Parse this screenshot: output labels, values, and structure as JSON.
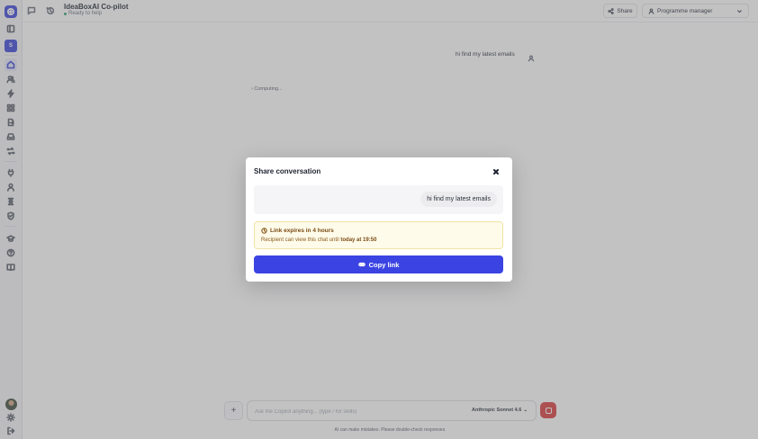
{
  "colors": {
    "accent": "#3b44e2",
    "stop_button": "#d93b3b",
    "warning_bg": "#fefbea",
    "status_online": "#29a36a"
  },
  "sidebar": {
    "workspace_badge": "S",
    "items": [
      {
        "icon": "logo-icon"
      },
      {
        "icon": "panel-toggle-icon"
      },
      {
        "icon": "workspace-badge"
      },
      {
        "icon": "home-icon",
        "active": true
      },
      {
        "icon": "users-icon"
      },
      {
        "icon": "lightning-icon"
      },
      {
        "icon": "grid-icon"
      },
      {
        "icon": "document-export-icon"
      },
      {
        "icon": "inbox-icon"
      },
      {
        "icon": "transfer-icon"
      },
      {
        "icon": "plug-icon"
      },
      {
        "icon": "person-icon"
      },
      {
        "icon": "hourglass-icon"
      },
      {
        "icon": "shield-icon"
      },
      {
        "icon": "graduation-cap-icon"
      },
      {
        "icon": "help-icon"
      },
      {
        "icon": "book-icon"
      },
      {
        "icon": "avatar"
      },
      {
        "icon": "sun-icon"
      },
      {
        "icon": "logout-icon"
      }
    ]
  },
  "header": {
    "title": "IdeaBoxAI Co-pilot",
    "status": "Ready to help",
    "share_label": "Share",
    "role_label": "Programme manager"
  },
  "chat": {
    "user_message": "hi find my latest emails",
    "computing_label": "Computing..."
  },
  "composer": {
    "placeholder": "Ask the Copilot anything... (type / for skills)",
    "model": "Anthropic Sonnet 4.6",
    "disclaimer": "AI can make mistakes. Please double-check responses."
  },
  "modal": {
    "title": "Share conversation",
    "preview_message": "hi find my latest emails",
    "warning_title": "Link expires in 4 hours",
    "warning_body_prefix": "Recipient can view this chat until",
    "warning_body_time": "today at 19:50",
    "copy_label": "Copy link"
  }
}
